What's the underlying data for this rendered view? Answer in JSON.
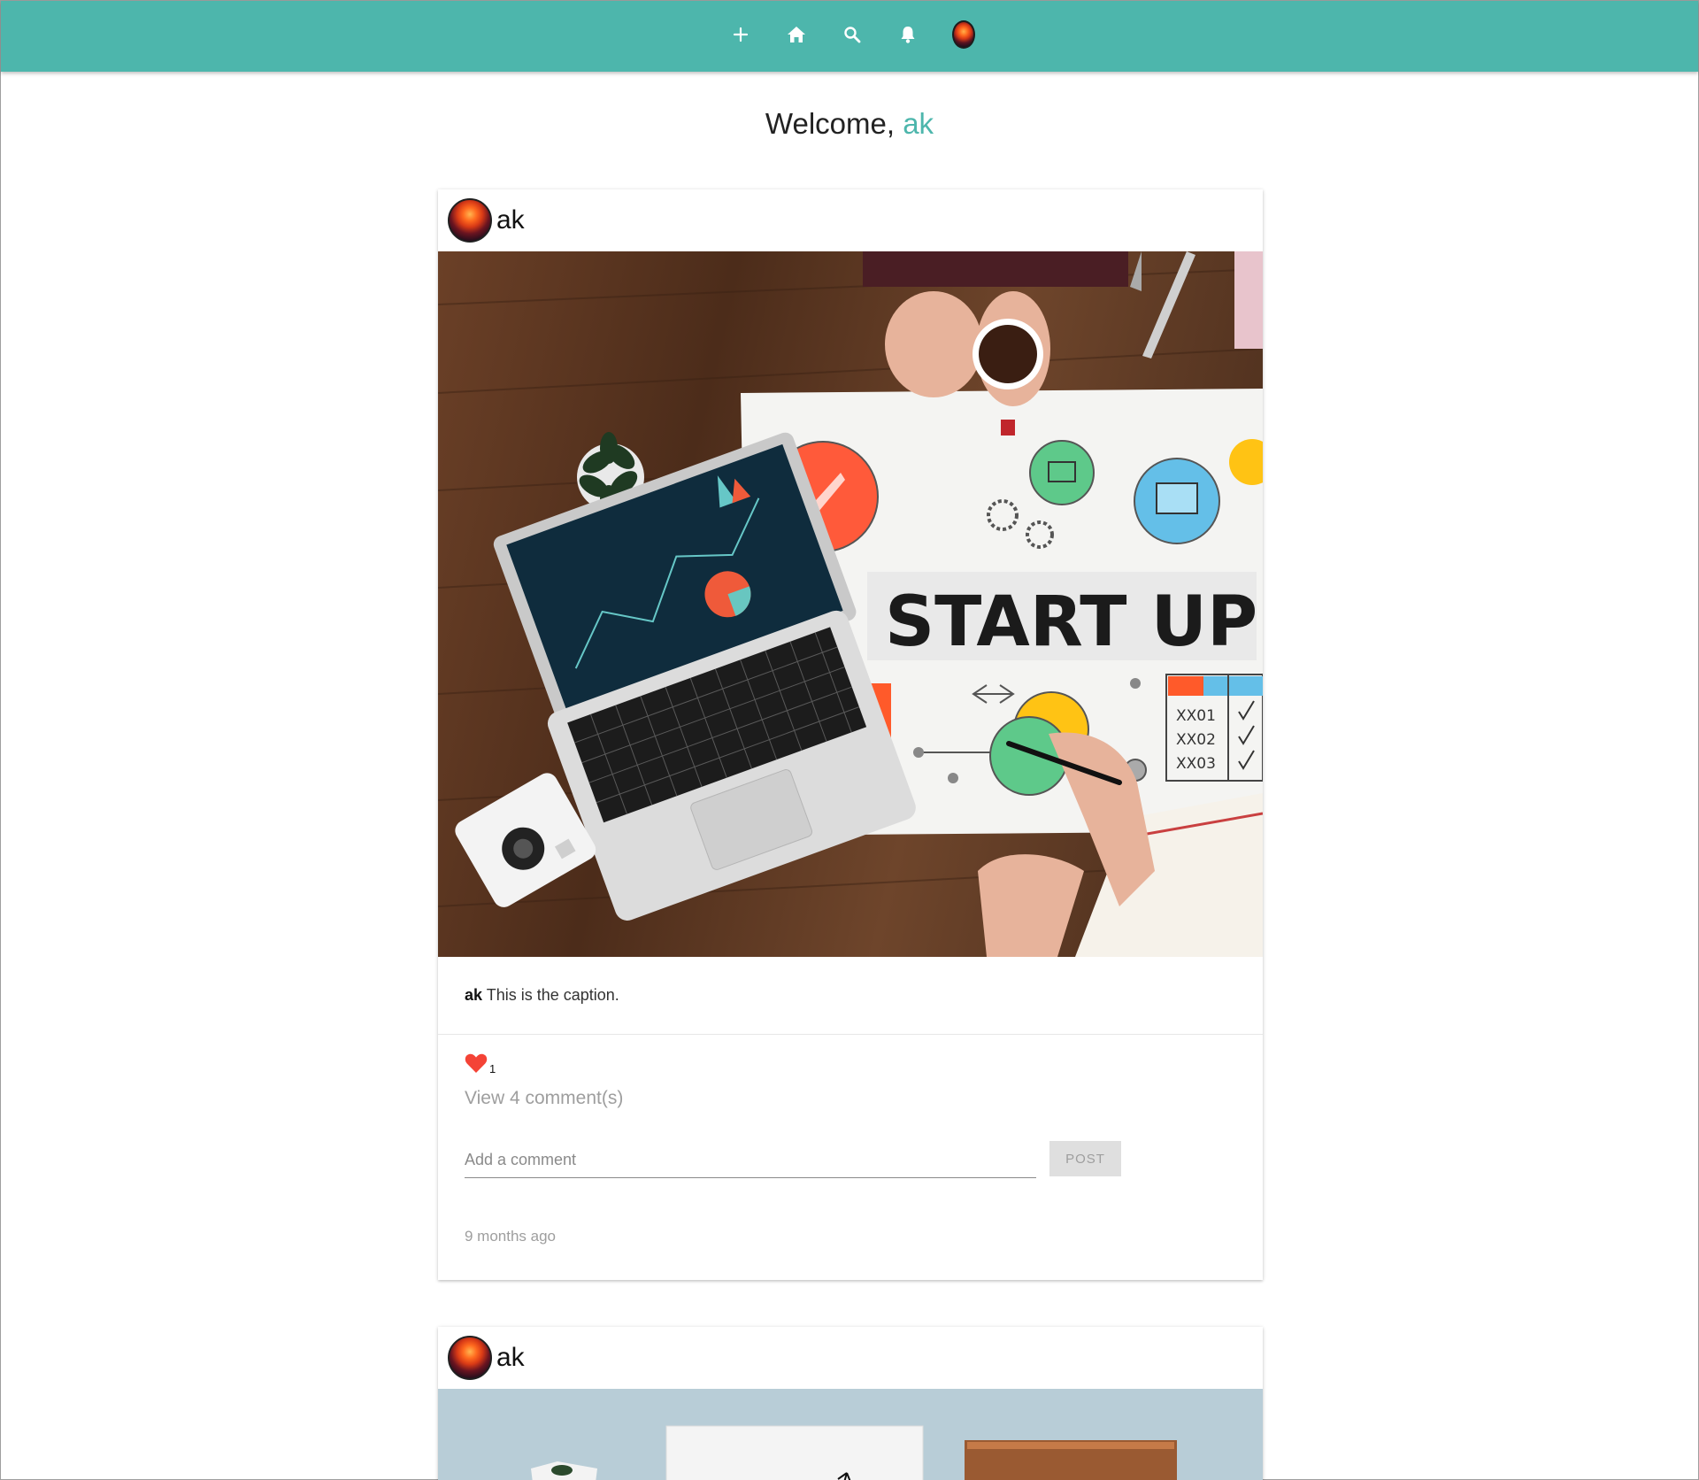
{
  "colors": {
    "accent": "#4db6ac",
    "like": "#f44336"
  },
  "navbar": {
    "items": [
      {
        "name": "add",
        "icon": "plus-icon"
      },
      {
        "name": "home",
        "icon": "home-icon"
      },
      {
        "name": "search",
        "icon": "search-icon"
      },
      {
        "name": "notifications",
        "icon": "bell-icon"
      },
      {
        "name": "profile",
        "icon": "avatar"
      }
    ]
  },
  "welcome": {
    "prefix": "Welcome, ",
    "username": "ak"
  },
  "posts": [
    {
      "username": "ak",
      "image_text": "START UP",
      "image_table": [
        "XX01",
        "XX02",
        "XX03"
      ],
      "caption_user": "ak",
      "caption_text": " This is the caption.",
      "likes": "1",
      "view_comments": "View 4 comment(s)",
      "comment_placeholder": "Add a comment",
      "post_button": "POST",
      "timestamp": "9 months ago"
    },
    {
      "username": "ak"
    }
  ]
}
